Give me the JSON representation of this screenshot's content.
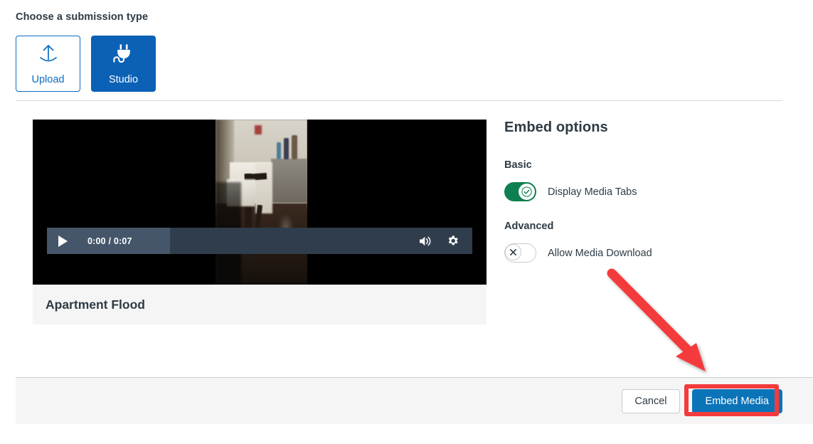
{
  "heading": "Choose a submission type",
  "submission_types": [
    {
      "label": "Upload",
      "icon": "upload-arrow-icon",
      "selected": false
    },
    {
      "label": "Studio",
      "icon": "plug-icon",
      "selected": true
    }
  ],
  "media": {
    "title": "Apartment Flood",
    "player": {
      "play_icon": "play-icon",
      "time": "0:00 / 0:07",
      "current_time": "0:00",
      "duration": "0:07",
      "volume_icon": "volume-icon",
      "settings_icon": "gear-icon"
    }
  },
  "embed_options": {
    "heading": "Embed options",
    "groups": [
      {
        "label": "Basic",
        "options": [
          {
            "label": "Display Media Tabs",
            "state": "on",
            "icon": "check-icon"
          }
        ]
      },
      {
        "label": "Advanced",
        "options": [
          {
            "label": "Allow Media Download",
            "state": "off",
            "icon": "close-x-icon"
          }
        ]
      }
    ]
  },
  "footer": {
    "cancel_label": "Cancel",
    "embed_label": "Embed Media"
  },
  "colors": {
    "brand_blue": "#0b61b5",
    "button_blue": "#0b74b8",
    "toggle_green": "#0e8050",
    "annotation_red": "#f43b3b",
    "text_dark": "#2d3b45",
    "panel_gray": "#f5f5f5"
  },
  "annotations": {
    "arrow": "red-arrow-pointing-to-embed-media",
    "highlight": "red-rectangle-around-embed-media"
  }
}
